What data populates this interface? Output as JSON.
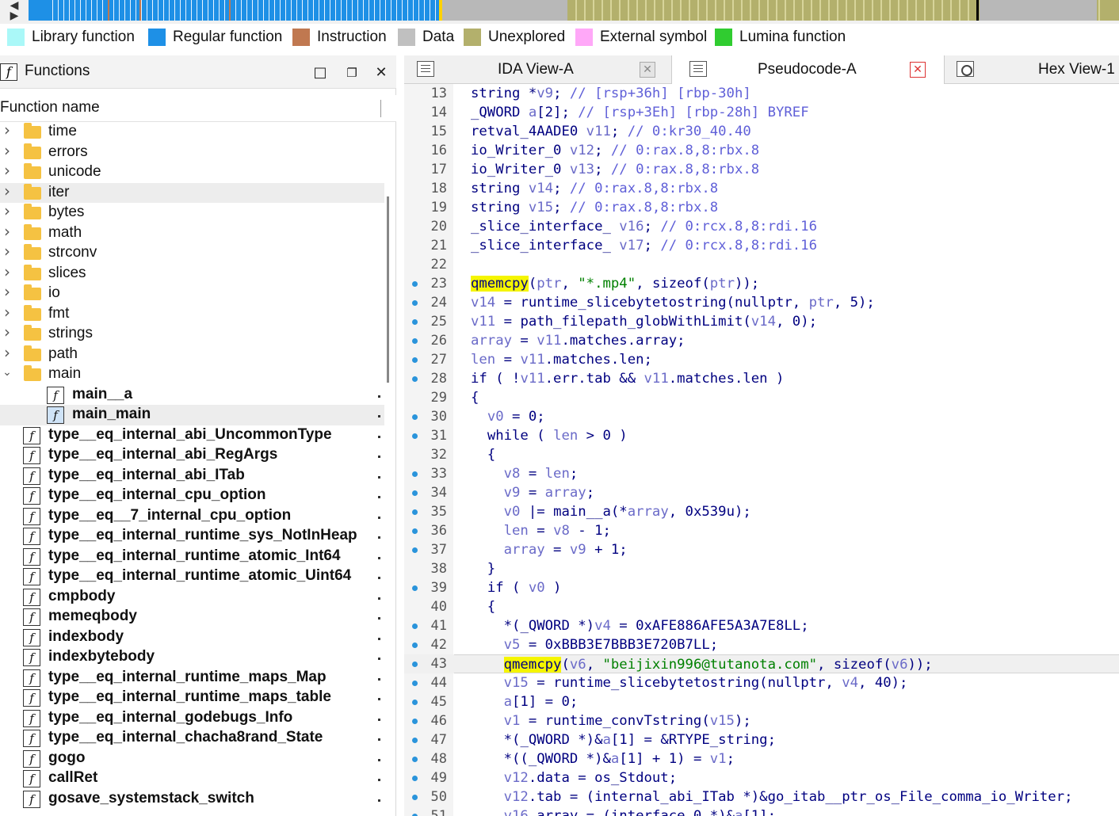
{
  "navigation_band": {
    "colors": {
      "regular": "#1e90e6",
      "unexplored": "#b3b06c",
      "data": "#b8b8b8",
      "cursor": "#000000",
      "external": "#ffa8f8",
      "lumina": "#30cc30",
      "library": "#aaf8f8",
      "instruction": "#c07850"
    }
  },
  "legend": [
    {
      "label": "Library function",
      "color": "#aaf8f8"
    },
    {
      "label": "Regular function",
      "color": "#1e90e6"
    },
    {
      "label": "Instruction",
      "color": "#c07850"
    },
    {
      "label": "Data",
      "color": "#c0c0c0"
    },
    {
      "label": "Unexplored",
      "color": "#b3b06c"
    },
    {
      "label": "External symbol",
      "color": "#ffa8f8"
    },
    {
      "label": "Lumina function",
      "color": "#30cc30"
    }
  ],
  "functions_panel": {
    "title": "Functions",
    "icon": "function-icon",
    "column_header": "Function name",
    "folders": [
      "time",
      "errors",
      "unicode",
      "iter",
      "bytes",
      "math",
      "strconv",
      "slices",
      "io",
      "fmt",
      "strings",
      "path",
      "main"
    ],
    "main_children": [
      "main__a",
      "main_main"
    ],
    "functions": [
      "type__eq_internal_abi_UncommonType",
      "type__eq_internal_abi_RegArgs",
      "type__eq_internal_abi_ITab",
      "type__eq_internal_cpu_option",
      "type__eq__7_internal_cpu_option",
      "type__eq_internal_runtime_sys_NotInHeap",
      "type__eq_internal_runtime_atomic_Int64",
      "type__eq_internal_runtime_atomic_Uint64",
      "cmpbody",
      "memeqbody",
      "indexbody",
      "indexbytebody",
      "type__eq_internal_runtime_maps_Map",
      "type__eq_internal_runtime_maps_table",
      "type__eq_internal_godebugs_Info",
      "type__eq_internal_chacha8rand_State",
      "gogo",
      "callRet",
      "gosave_systemstack_switch"
    ]
  },
  "tabs": [
    {
      "label": "IDA View-A",
      "icon": "listing-icon",
      "active": false
    },
    {
      "label": "Pseudocode-A",
      "icon": "listing-icon",
      "active": true
    },
    {
      "label": "Hex View-1",
      "icon": "hex-icon",
      "active": false
    }
  ],
  "code": {
    "lines": [
      {
        "n": "13",
        "bp": false,
        "tokens": [
          [
            "ty",
            "string "
          ],
          [
            "",
            "*"
          ],
          [
            "vr",
            "v9"
          ],
          [
            "",
            "; "
          ],
          [
            "cm",
            "// [rsp+36h] [rbp-30h]"
          ]
        ]
      },
      {
        "n": "14",
        "bp": false,
        "tokens": [
          [
            "ty",
            "_QWORD "
          ],
          [
            "vr",
            "a"
          ],
          [
            "",
            "[2]; "
          ],
          [
            "cm",
            "// [rsp+3Eh] [rbp-28h] BYREF"
          ]
        ]
      },
      {
        "n": "15",
        "bp": false,
        "tokens": [
          [
            "ty",
            "retval_4AADE0 "
          ],
          [
            "vr",
            "v11"
          ],
          [
            "",
            "; "
          ],
          [
            "cm",
            "// 0:kr30_40.40"
          ]
        ]
      },
      {
        "n": "16",
        "bp": false,
        "tokens": [
          [
            "ty",
            "io_Writer_0 "
          ],
          [
            "vr",
            "v12"
          ],
          [
            "",
            "; "
          ],
          [
            "cm",
            "// 0:rax.8,8:rbx.8"
          ]
        ]
      },
      {
        "n": "17",
        "bp": false,
        "tokens": [
          [
            "ty",
            "io_Writer_0 "
          ],
          [
            "vr",
            "v13"
          ],
          [
            "",
            "; "
          ],
          [
            "cm",
            "// 0:rax.8,8:rbx.8"
          ]
        ]
      },
      {
        "n": "18",
        "bp": false,
        "tokens": [
          [
            "ty",
            "string "
          ],
          [
            "vr",
            "v14"
          ],
          [
            "",
            "; "
          ],
          [
            "cm",
            "// 0:rax.8,8:rbx.8"
          ]
        ]
      },
      {
        "n": "19",
        "bp": false,
        "tokens": [
          [
            "ty",
            "string "
          ],
          [
            "vr",
            "v15"
          ],
          [
            "",
            "; "
          ],
          [
            "cm",
            "// 0:rax.8,8:rbx.8"
          ]
        ]
      },
      {
        "n": "20",
        "bp": false,
        "tokens": [
          [
            "ty",
            "_slice_interface_ "
          ],
          [
            "vr",
            "v16"
          ],
          [
            "",
            "; "
          ],
          [
            "cm",
            "// 0:rcx.8,8:rdi.16"
          ]
        ]
      },
      {
        "n": "21",
        "bp": false,
        "tokens": [
          [
            "ty",
            "_slice_interface_ "
          ],
          [
            "vr",
            "v17"
          ],
          [
            "",
            "; "
          ],
          [
            "cm",
            "// 0:rcx.8,8:rdi.16"
          ]
        ]
      },
      {
        "n": "22",
        "bp": false,
        "tokens": []
      },
      {
        "n": "23",
        "bp": true,
        "tokens": [
          [
            "hl",
            "qmemcpy"
          ],
          [
            "",
            "("
          ],
          [
            "vr",
            "ptr"
          ],
          [
            "",
            ", "
          ],
          [
            "st",
            "\"*.mp4\""
          ],
          [
            "",
            ", "
          ],
          [
            "fn",
            "sizeof"
          ],
          [
            "",
            "("
          ],
          [
            "vr",
            "ptr"
          ],
          [
            "",
            "));"
          ]
        ]
      },
      {
        "n": "24",
        "bp": true,
        "tokens": [
          [
            "vr",
            "v14"
          ],
          [
            "",
            " = "
          ],
          [
            "fn",
            "runtime_slicebytetostring"
          ],
          [
            "",
            "(nullptr, "
          ],
          [
            "vr",
            "ptr"
          ],
          [
            "",
            ", 5);"
          ]
        ]
      },
      {
        "n": "25",
        "bp": true,
        "tokens": [
          [
            "vr",
            "v11"
          ],
          [
            "",
            " = "
          ],
          [
            "fn",
            "path_filepath_globWithLimit"
          ],
          [
            "",
            "("
          ],
          [
            "vr",
            "v14"
          ],
          [
            "",
            ", 0);"
          ]
        ]
      },
      {
        "n": "26",
        "bp": true,
        "tokens": [
          [
            "vr",
            "array"
          ],
          [
            "",
            " = "
          ],
          [
            "vr",
            "v11"
          ],
          [
            "",
            ".matches.array;"
          ]
        ]
      },
      {
        "n": "27",
        "bp": true,
        "tokens": [
          [
            "vr",
            "len"
          ],
          [
            "",
            " = "
          ],
          [
            "vr",
            "v11"
          ],
          [
            "",
            ".matches.len;"
          ]
        ]
      },
      {
        "n": "28",
        "bp": true,
        "tokens": [
          [
            "kw",
            "if"
          ],
          [
            "",
            " ( !"
          ],
          [
            "vr",
            "v11"
          ],
          [
            "",
            ".err.tab && "
          ],
          [
            "vr",
            "v11"
          ],
          [
            "",
            ".matches.len )"
          ]
        ]
      },
      {
        "n": "29",
        "bp": false,
        "tokens": [
          [
            "",
            "{"
          ]
        ]
      },
      {
        "n": "30",
        "bp": true,
        "tokens": [
          [
            "",
            "  "
          ],
          [
            "vr",
            "v0"
          ],
          [
            "",
            " = 0;"
          ]
        ]
      },
      {
        "n": "31",
        "bp": true,
        "tokens": [
          [
            "",
            "  "
          ],
          [
            "kw",
            "while"
          ],
          [
            "",
            " ( "
          ],
          [
            "vr",
            "len"
          ],
          [
            "",
            " > 0 )"
          ]
        ]
      },
      {
        "n": "32",
        "bp": false,
        "tokens": [
          [
            "",
            "  {"
          ]
        ]
      },
      {
        "n": "33",
        "bp": true,
        "tokens": [
          [
            "",
            "    "
          ],
          [
            "vr",
            "v8"
          ],
          [
            "",
            " = "
          ],
          [
            "vr",
            "len"
          ],
          [
            "",
            ";"
          ]
        ]
      },
      {
        "n": "34",
        "bp": true,
        "tokens": [
          [
            "",
            "    "
          ],
          [
            "vr",
            "v9"
          ],
          [
            "",
            " = "
          ],
          [
            "vr",
            "array"
          ],
          [
            "",
            ";"
          ]
        ]
      },
      {
        "n": "35",
        "bp": true,
        "tokens": [
          [
            "",
            "    "
          ],
          [
            "vr",
            "v0"
          ],
          [
            "",
            " |= "
          ],
          [
            "fn",
            "main__a"
          ],
          [
            "",
            "(*"
          ],
          [
            "vr",
            "array"
          ],
          [
            "",
            ", 0x539u);"
          ]
        ]
      },
      {
        "n": "36",
        "bp": true,
        "tokens": [
          [
            "",
            "    "
          ],
          [
            "vr",
            "len"
          ],
          [
            "",
            " = "
          ],
          [
            "vr",
            "v8"
          ],
          [
            "",
            " - 1;"
          ]
        ]
      },
      {
        "n": "37",
        "bp": true,
        "tokens": [
          [
            "",
            "    "
          ],
          [
            "vr",
            "array"
          ],
          [
            "",
            " = "
          ],
          [
            "vr",
            "v9"
          ],
          [
            "",
            " + 1;"
          ]
        ]
      },
      {
        "n": "38",
        "bp": false,
        "tokens": [
          [
            "",
            "  }"
          ]
        ]
      },
      {
        "n": "39",
        "bp": true,
        "tokens": [
          [
            "",
            "  "
          ],
          [
            "kw",
            "if"
          ],
          [
            "",
            " ( "
          ],
          [
            "vr",
            "v0"
          ],
          [
            "",
            " )"
          ]
        ]
      },
      {
        "n": "40",
        "bp": false,
        "tokens": [
          [
            "",
            "  {"
          ]
        ]
      },
      {
        "n": "41",
        "bp": true,
        "tokens": [
          [
            "",
            "    *("
          ],
          [
            "ty",
            "_QWORD"
          ],
          [
            "",
            " *)"
          ],
          [
            "vr",
            "v4"
          ],
          [
            "",
            " = 0xAFE886AFE5A3A7E8LL;"
          ]
        ]
      },
      {
        "n": "42",
        "bp": true,
        "tokens": [
          [
            "",
            "    "
          ],
          [
            "vr",
            "v5"
          ],
          [
            "",
            " = 0xBBB3E7BBB3E720B7LL;"
          ]
        ]
      },
      {
        "n": "43",
        "bp": true,
        "cursor": true,
        "tokens": [
          [
            "",
            "    "
          ],
          [
            "hl",
            "qmemcpy"
          ],
          [
            "",
            "("
          ],
          [
            "vr",
            "v6"
          ],
          [
            "",
            ", "
          ],
          [
            "st",
            "\"beijixin996@tutanota.com\""
          ],
          [
            "",
            ", "
          ],
          [
            "fn",
            "sizeof"
          ],
          [
            "",
            "("
          ],
          [
            "vr",
            "v6"
          ],
          [
            "",
            "));"
          ]
        ]
      },
      {
        "n": "44",
        "bp": true,
        "tokens": [
          [
            "",
            "    "
          ],
          [
            "vr",
            "v15"
          ],
          [
            "",
            " = "
          ],
          [
            "fn",
            "runtime_slicebytetostring"
          ],
          [
            "",
            "(nullptr, "
          ],
          [
            "vr",
            "v4"
          ],
          [
            "",
            ", 40);"
          ]
        ]
      },
      {
        "n": "45",
        "bp": true,
        "tokens": [
          [
            "",
            "    "
          ],
          [
            "vr",
            "a"
          ],
          [
            "",
            "[1] = 0;"
          ]
        ]
      },
      {
        "n": "46",
        "bp": true,
        "tokens": [
          [
            "",
            "    "
          ],
          [
            "vr",
            "v1"
          ],
          [
            "",
            " = "
          ],
          [
            "fn",
            "runtime_convTstring"
          ],
          [
            "",
            "("
          ],
          [
            "vr",
            "v15"
          ],
          [
            "",
            ");"
          ]
        ]
      },
      {
        "n": "47",
        "bp": true,
        "tokens": [
          [
            "",
            "    *("
          ],
          [
            "ty",
            "_QWORD"
          ],
          [
            "",
            " *)&"
          ],
          [
            "vr",
            "a"
          ],
          [
            "",
            "[1] = &RTYPE_string;"
          ]
        ]
      },
      {
        "n": "48",
        "bp": true,
        "tokens": [
          [
            "",
            "    *(("
          ],
          [
            "ty",
            "_QWORD"
          ],
          [
            "",
            " *)&"
          ],
          [
            "vr",
            "a"
          ],
          [
            "",
            "[1] + 1) = "
          ],
          [
            "vr",
            "v1"
          ],
          [
            "",
            ";"
          ]
        ]
      },
      {
        "n": "49",
        "bp": true,
        "tokens": [
          [
            "",
            "    "
          ],
          [
            "vr",
            "v12"
          ],
          [
            "",
            ".data = os_Stdout;"
          ]
        ]
      },
      {
        "n": "50",
        "bp": true,
        "tokens": [
          [
            "",
            "    "
          ],
          [
            "vr",
            "v12"
          ],
          [
            "",
            ".tab = ("
          ],
          [
            "ty",
            "internal_abi_ITab"
          ],
          [
            "",
            " *)&go_itab__ptr_os_File_comma_io_Writer;"
          ]
        ]
      },
      {
        "n": "51",
        "bp": true,
        "tokens": [
          [
            "",
            "    "
          ],
          [
            "vr",
            "v16"
          ],
          [
            "",
            ".array = ("
          ],
          [
            "ty",
            "interface_0"
          ],
          [
            "",
            " *)&"
          ],
          [
            "vr",
            "a"
          ],
          [
            "",
            "[1];"
          ]
        ]
      }
    ]
  }
}
